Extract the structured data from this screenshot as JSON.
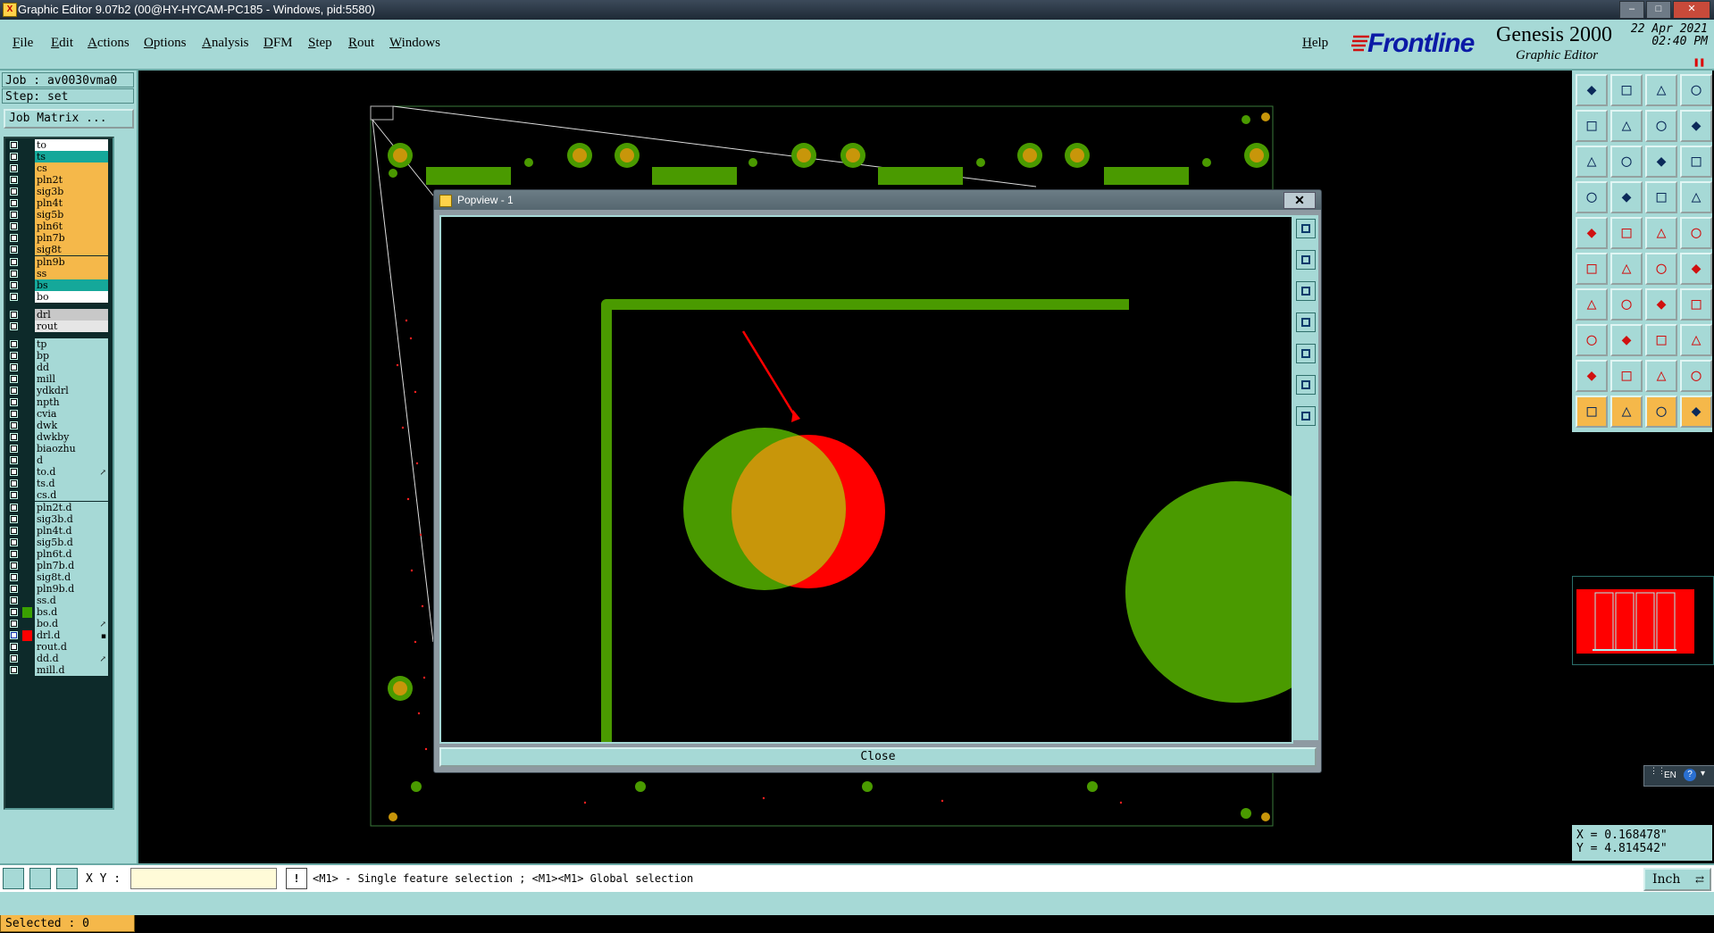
{
  "window": {
    "title": "Graphic Editor 9.07b2 (00@HY-HYCAM-PC185 - Windows, pid:5580)",
    "controls": [
      "minimize",
      "maximize",
      "close"
    ]
  },
  "menu": {
    "items": [
      "File",
      "Edit",
      "Actions",
      "Options",
      "Analysis",
      "DFM",
      "Step",
      "Rout",
      "Windows"
    ],
    "help": "Help"
  },
  "brand": {
    "logo": "Frontline",
    "product": "Genesis 2000",
    "subtitle": "Graphic Editor",
    "date": "22 Apr 2021",
    "time": "02:40 PM"
  },
  "left_panel": {
    "job": "Job : av0030vma0",
    "step": "Step: set",
    "job_matrix": "Job Matrix ...",
    "layers": [
      {
        "name": "to",
        "color": "#ffffff",
        "swatch": null,
        "mark": ""
      },
      {
        "name": "ts",
        "color": "#15a89a",
        "swatch": null,
        "mark": ""
      },
      {
        "name": "cs",
        "color": "#f5b84a",
        "swatch": null,
        "mark": ""
      },
      {
        "name": "pln2t",
        "color": "#f5b84a",
        "swatch": null,
        "mark": ""
      },
      {
        "name": "sig3b",
        "color": "#f5b84a",
        "swatch": null,
        "mark": ""
      },
      {
        "name": "pln4t",
        "color": "#f5b84a",
        "swatch": null,
        "mark": ""
      },
      {
        "name": "sig5b",
        "color": "#f5b84a",
        "swatch": null,
        "mark": ""
      },
      {
        "name": "pln6t",
        "color": "#f5b84a",
        "swatch": null,
        "mark": ""
      },
      {
        "name": "pln7b",
        "color": "#f5b84a",
        "swatch": null,
        "mark": ""
      },
      {
        "name": "sig8t",
        "color": "#f5b84a",
        "swatch": null,
        "mark": ""
      },
      {
        "name": "pln9b",
        "color": "#f5b84a",
        "swatch": null,
        "mark": ""
      },
      {
        "name": "ss",
        "color": "#f5b84a",
        "swatch": null,
        "mark": ""
      },
      {
        "name": "bs",
        "color": "#15a89a",
        "swatch": null,
        "mark": ""
      },
      {
        "name": "bo",
        "color": "#ffffff",
        "swatch": null,
        "mark": ""
      },
      {
        "name": "drl",
        "color": "#c8c8c8",
        "swatch": null,
        "mark": ""
      },
      {
        "name": "rout",
        "color": "#e6e6e6",
        "swatch": null,
        "mark": ""
      },
      {
        "name": "tp",
        "color": "#a6d9d6",
        "swatch": null,
        "mark": ""
      },
      {
        "name": "bp",
        "color": "#a6d9d6",
        "swatch": null,
        "mark": ""
      },
      {
        "name": "dd",
        "color": "#a6d9d6",
        "swatch": null,
        "mark": ""
      },
      {
        "name": "mill",
        "color": "#a6d9d6",
        "swatch": null,
        "mark": ""
      },
      {
        "name": "ydkdrl",
        "color": "#a6d9d6",
        "swatch": null,
        "mark": ""
      },
      {
        "name": "npth",
        "color": "#a6d9d6",
        "swatch": null,
        "mark": ""
      },
      {
        "name": "cvia",
        "color": "#a6d9d6",
        "swatch": null,
        "mark": ""
      },
      {
        "name": "dwk",
        "color": "#a6d9d6",
        "swatch": null,
        "mark": ""
      },
      {
        "name": "dwkby",
        "color": "#a6d9d6",
        "swatch": null,
        "mark": ""
      },
      {
        "name": "biaozhu",
        "color": "#a6d9d6",
        "swatch": null,
        "mark": ""
      },
      {
        "name": "d",
        "color": "#a6d9d6",
        "swatch": null,
        "mark": ""
      },
      {
        "name": "to.d",
        "color": "#a6d9d6",
        "swatch": null,
        "mark": "↗"
      },
      {
        "name": "ts.d",
        "color": "#a6d9d6",
        "swatch": null,
        "mark": ""
      },
      {
        "name": "cs.d",
        "color": "#a6d9d6",
        "swatch": null,
        "mark": ""
      },
      {
        "name": "pln2t.d",
        "color": "#a6d9d6",
        "swatch": null,
        "mark": ""
      },
      {
        "name": "sig3b.d",
        "color": "#a6d9d6",
        "swatch": null,
        "mark": ""
      },
      {
        "name": "pln4t.d",
        "color": "#a6d9d6",
        "swatch": null,
        "mark": ""
      },
      {
        "name": "sig5b.d",
        "color": "#a6d9d6",
        "swatch": null,
        "mark": ""
      },
      {
        "name": "pln6t.d",
        "color": "#a6d9d6",
        "swatch": null,
        "mark": ""
      },
      {
        "name": "pln7b.d",
        "color": "#a6d9d6",
        "swatch": null,
        "mark": ""
      },
      {
        "name": "sig8t.d",
        "color": "#a6d9d6",
        "swatch": null,
        "mark": ""
      },
      {
        "name": "pln9b.d",
        "color": "#a6d9d6",
        "swatch": null,
        "mark": ""
      },
      {
        "name": "ss.d",
        "color": "#a6d9d6",
        "swatch": null,
        "mark": ""
      },
      {
        "name": "bs.d",
        "color": "#a6d9d6",
        "swatch": "#3aa000",
        "mark": ""
      },
      {
        "name": "bo.d",
        "color": "#a6d9d6",
        "swatch": null,
        "mark": "↗"
      },
      {
        "name": "drl.d",
        "color": "#a6d9d6",
        "swatch": "#ff0000",
        "mark": "▪"
      },
      {
        "name": "rout.d",
        "color": "#a6d9d6",
        "swatch": null,
        "mark": ""
      },
      {
        "name": "dd.d",
        "color": "#a6d9d6",
        "swatch": null,
        "mark": "↗"
      },
      {
        "name": "mill.d",
        "color": "#a6d9d6",
        "swatch": null,
        "mark": ""
      }
    ],
    "selected": "Selected : 0"
  },
  "popview": {
    "title": "Popview - 1",
    "close_x": "✕",
    "close_button": "Close",
    "colors": {
      "trace": "#4a9a00",
      "pad": "#4a9a00",
      "drill": "#ff0000",
      "overlap": "#c8960a",
      "arrow": "#ff0000"
    }
  },
  "right_panel": {
    "tools_rows": 10,
    "coords": {
      "x": "X = 0.168478\"",
      "y": "Y = 4.814542\""
    },
    "ime": "EN"
  },
  "statusbar": {
    "xy_label": "X Y :",
    "xy_value": "",
    "message_icon": "!",
    "message": "<M1> - Single feature selection ; <M1><M1> Global selection",
    "unit": "Inch"
  }
}
